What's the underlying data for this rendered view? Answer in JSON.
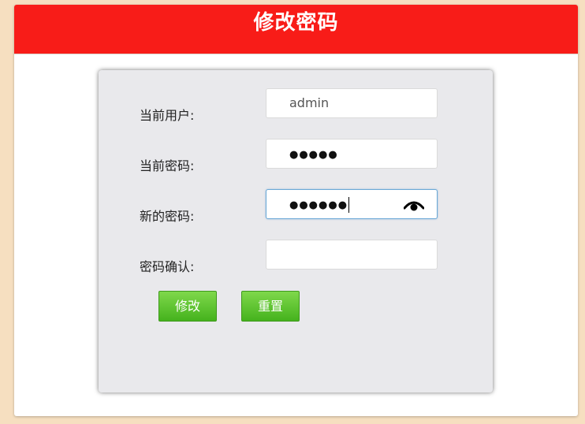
{
  "window": {
    "title": "修改密码"
  },
  "form": {
    "current_user_label": "当前用户:",
    "current_user_value": "admin",
    "current_password_label": "当前密码:",
    "current_password_mask": "●●●●●",
    "new_password_label": "新的密码:",
    "new_password_mask": "●●●●●●",
    "confirm_label": "密码确认:",
    "confirm_value": ""
  },
  "buttons": {
    "submit_label": "修改",
    "reset_label": "重置"
  },
  "colors": {
    "titlebar": "#f81c18",
    "button_green": "#45b21d",
    "page_background": "#f6dfc0",
    "focus_border": "#6aa8d6"
  },
  "icons": {
    "show_password": "eye-icon"
  }
}
